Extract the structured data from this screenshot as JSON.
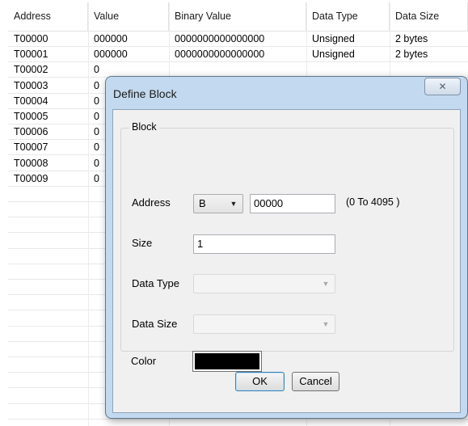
{
  "grid": {
    "columns": [
      "Address",
      "Value",
      "Binary Value",
      "Data Type",
      "Data Size"
    ],
    "rows": [
      [
        "T00000",
        "000000",
        "0000000000000000",
        "Unsigned",
        "2 bytes"
      ],
      [
        "T00001",
        "000000",
        "0000000000000000",
        "Unsigned",
        "2 bytes"
      ],
      [
        "T00002",
        "0",
        "",
        "",
        ""
      ],
      [
        "T00003",
        "0",
        "",
        "",
        ""
      ],
      [
        "T00004",
        "0",
        "",
        "",
        ""
      ],
      [
        "T00005",
        "0",
        "",
        "",
        ""
      ],
      [
        "T00006",
        "0",
        "",
        "",
        ""
      ],
      [
        "T00007",
        "0",
        "",
        "",
        ""
      ],
      [
        "T00008",
        "0",
        "",
        "",
        ""
      ],
      [
        "T00009",
        "0",
        "",
        "",
        ""
      ]
    ]
  },
  "dialog": {
    "title": "Define Block",
    "close_icon": "close-x-icon",
    "group_title": "Block",
    "address_label": "Address",
    "address_type": "B",
    "address_value": "00000",
    "address_range": "(0 To 4095 )",
    "size_label": "Size",
    "size_value": "1",
    "data_type_label": "Data Type",
    "data_type_value": "",
    "data_size_label": "Data Size",
    "data_size_value": "",
    "color_label": "Color",
    "color_value": "#000000",
    "ok_label": "OK",
    "cancel_label": "Cancel"
  }
}
